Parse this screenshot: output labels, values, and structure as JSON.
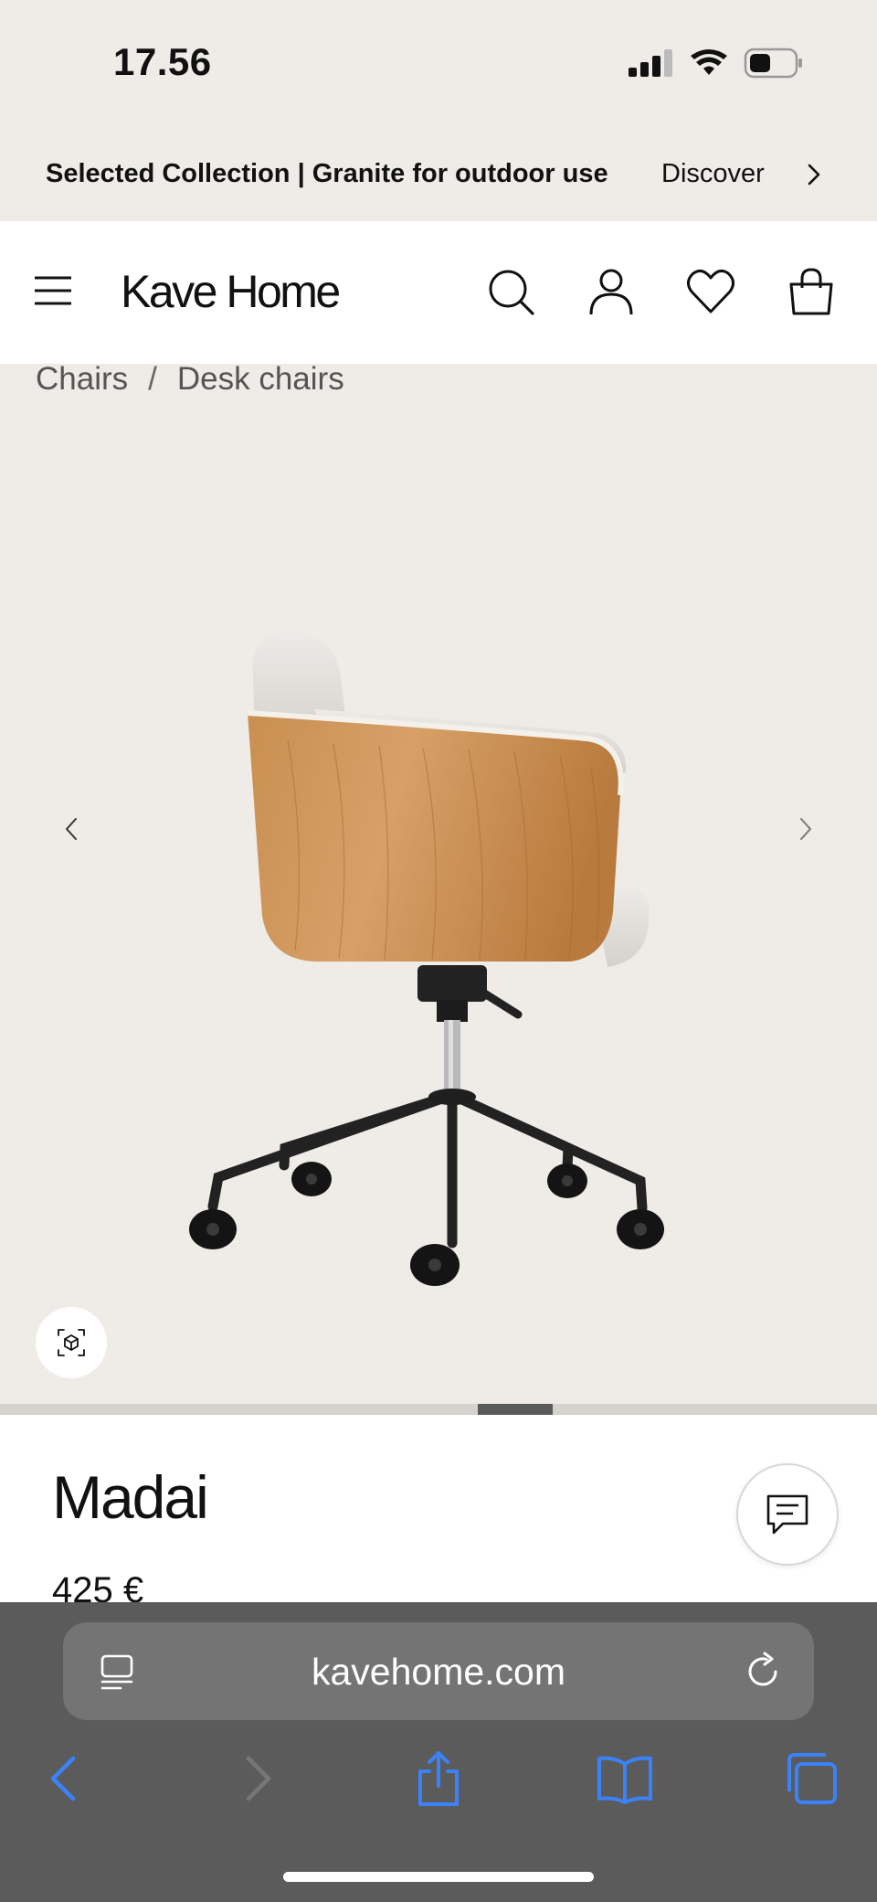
{
  "status_bar": {
    "time": "17.56"
  },
  "promo": {
    "title": "Selected Collection | Granite for outdoor use",
    "link": "Discover"
  },
  "header": {
    "logo": "Kave Home"
  },
  "breadcrumb": {
    "items": [
      "Chairs",
      "Desk chairs"
    ],
    "separator": "/"
  },
  "gallery": {
    "progress": 0.1,
    "progress_start": 0.545
  },
  "product": {
    "name": "Madai",
    "price": "425 €"
  },
  "browser": {
    "url": "kavehome.com"
  },
  "colors": {
    "page_bg": "#efebe7",
    "header_bg": "#ffffff",
    "browser_bg": "#5b5b5c",
    "browser_accent": "#3b82f6"
  },
  "icons": [
    "signal-icon",
    "wifi-icon",
    "battery-icon",
    "chevron-right-icon",
    "menu-icon",
    "search-icon",
    "account-icon",
    "heart-icon",
    "bag-icon",
    "arrow-left-icon",
    "arrow-right-icon",
    "ar-view-icon",
    "chat-icon",
    "tab-overview-icon",
    "reload-icon",
    "back-icon",
    "forward-icon",
    "share-icon",
    "bookmarks-icon",
    "tabs-icon"
  ]
}
